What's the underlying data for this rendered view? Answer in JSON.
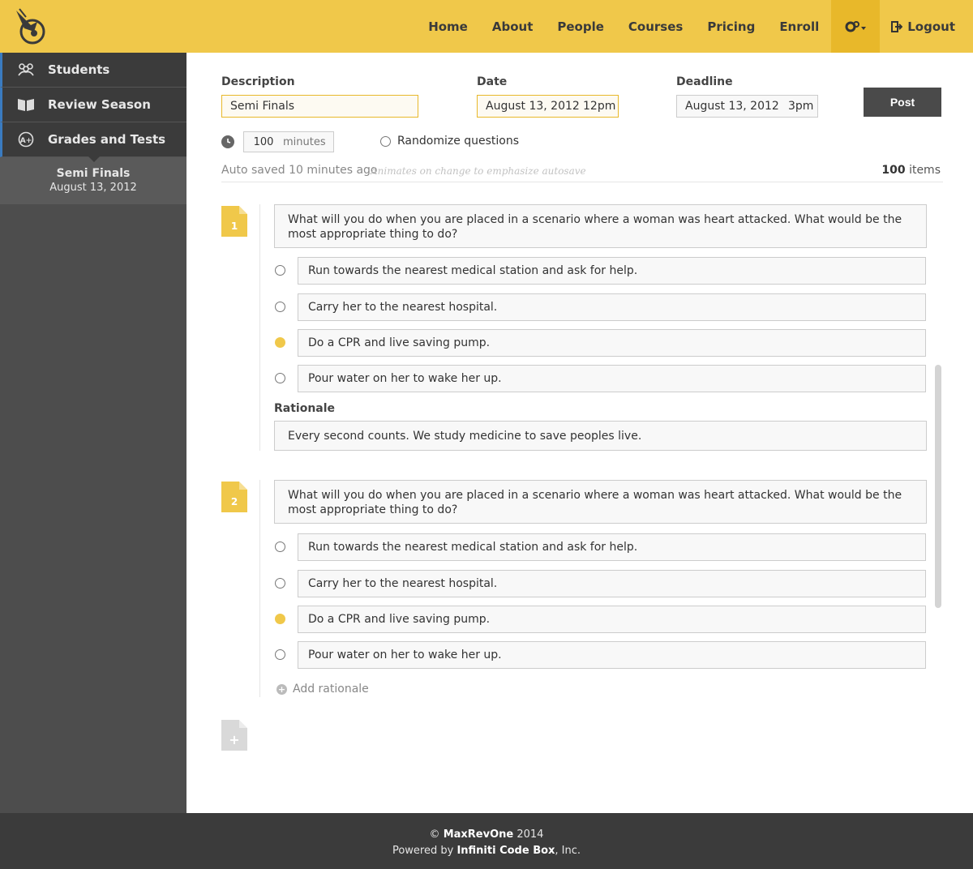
{
  "nav": {
    "items": [
      "Home",
      "About",
      "People",
      "Courses",
      "Pricing",
      "Enroll"
    ],
    "logout": "Logout"
  },
  "sidebar": {
    "items": [
      {
        "label": "Students",
        "icon": "users-icon"
      },
      {
        "label": "Review Season",
        "icon": "book-icon"
      },
      {
        "label": "Grades and Tests",
        "icon": "grade-icon"
      }
    ],
    "active_sub": {
      "title": "Semi Finals",
      "date": "August 13, 2012"
    }
  },
  "form": {
    "description_label": "Description",
    "description_value": "Semi Finals",
    "date_label": "Date",
    "date_value": "August 13, 2012",
    "date_time": "12pm",
    "deadline_label": "Deadline",
    "deadline_value": "August 13, 2012",
    "deadline_time": "3pm",
    "post_label": "Post",
    "minutes_value": "100",
    "minutes_unit": "minutes",
    "randomize_label": "Randomize questions",
    "autosave": "Auto saved 10 minutes ago",
    "autosave_note": "Animates on change to emphasize autosave",
    "items_count": "100",
    "items_label": "items"
  },
  "questions": [
    {
      "number": "1",
      "text": "What will you do when you are placed in a scenario where a woman was heart attacked. What would be the most appropriate thing to do?",
      "options": [
        "Run towards the nearest medical station and ask for help.",
        "Carry her to the nearest hospital.",
        "Do a CPR and live saving pump.",
        "Pour water on her to wake her up."
      ],
      "selected": 2,
      "rationale_label": "Rationale",
      "rationale": "Every second counts. We study medicine to save peoples live."
    },
    {
      "number": "2",
      "text": "What will you do when you are placed in a scenario where a woman was heart attacked. What would be the most appropriate thing to do?",
      "options": [
        "Run towards the nearest medical station and ask for help.",
        "Carry her to the nearest hospital.",
        "Do a CPR and live saving pump.",
        "Pour water on her to wake her up."
      ],
      "selected": 2,
      "add_rationale": "Add rationale"
    }
  ],
  "footer": {
    "copy": "©",
    "brand": "MaxRevOne",
    "year": "2014",
    "powered_prefix": "Powered by",
    "powered_brand": "Infiniti Code Box",
    "powered_suffix": ", Inc."
  },
  "colors": {
    "accent": "#f0c84a",
    "dark": "#3b3b3b",
    "sidebar": "#4d4d4d"
  }
}
